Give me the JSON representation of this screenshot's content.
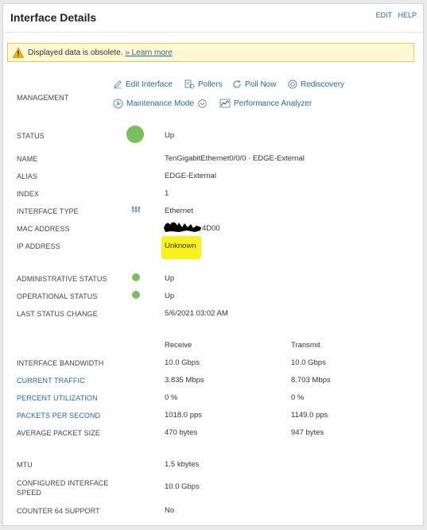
{
  "header": {
    "title": "Interface Details",
    "edit": "EDIT",
    "help": "HELP"
  },
  "warning": {
    "text": "Displayed data is obsolete.",
    "link": "» Learn more"
  },
  "management": {
    "label": "MANAGEMENT",
    "edit_interface": "Edit Interface",
    "pollers": "Pollers",
    "poll_now": "Poll Now",
    "rediscovery": "Rediscovery",
    "maintenance_mode": "Maintenance Mode",
    "performance_analyzer": "Performance Analyzer"
  },
  "status": {
    "label": "STATUS",
    "value": "Up",
    "color": "#77c05c"
  },
  "name": {
    "label": "NAME",
    "value": "TenGigabitEthernet0/0/0 · EDGE-External"
  },
  "alias": {
    "label": "ALIAS",
    "value": "EDGE-External"
  },
  "index": {
    "label": "INDEX",
    "value": "1"
  },
  "interface_type": {
    "label": "INTERFACE TYPE",
    "value": "Ethernet"
  },
  "mac": {
    "label": "MAC ADDRESS",
    "value": "4D00"
  },
  "ip": {
    "label": "IP ADDRESS",
    "value": "Unknown"
  },
  "admin_status": {
    "label": "ADMINISTRATIVE STATUS",
    "value": "Up"
  },
  "oper_status": {
    "label": "OPERATIONAL STATUS",
    "value": "Up"
  },
  "last_change": {
    "label": "LAST STATUS CHANGE",
    "value": "5/6/2021 03:02 AM"
  },
  "traffic": {
    "col_receive": "Receive",
    "col_transmit": "Transmit",
    "rows": [
      {
        "label": "INTERFACE BANDWIDTH",
        "receive": "10.0 Gbps",
        "transmit": "10.0 Gbps",
        "link": false
      },
      {
        "label": "CURRENT TRAFFIC",
        "receive": "3.835 Mbps",
        "transmit": "8.703 Mbps",
        "link": true
      },
      {
        "label": "PERCENT UTILIZATION",
        "receive": "0 %",
        "transmit": "0 %",
        "link": true
      },
      {
        "label": "PACKETS PER SECOND",
        "receive": "1018.0 pps",
        "transmit": "1149.0 pps",
        "link": true
      },
      {
        "label": "AVERAGE PACKET SIZE",
        "receive": "470 bytes",
        "transmit": "947 bytes",
        "link": false
      }
    ]
  },
  "mtu": {
    "label": "MTU",
    "value": "1.5 kbytes"
  },
  "configured_speed": {
    "label_line1": "CONFIGURED INTERFACE",
    "label_line2": "SPEED",
    "value": "10.0 Gbps"
  },
  "counter64": {
    "label": "COUNTER 64 SUPPORT",
    "value": "No"
  }
}
